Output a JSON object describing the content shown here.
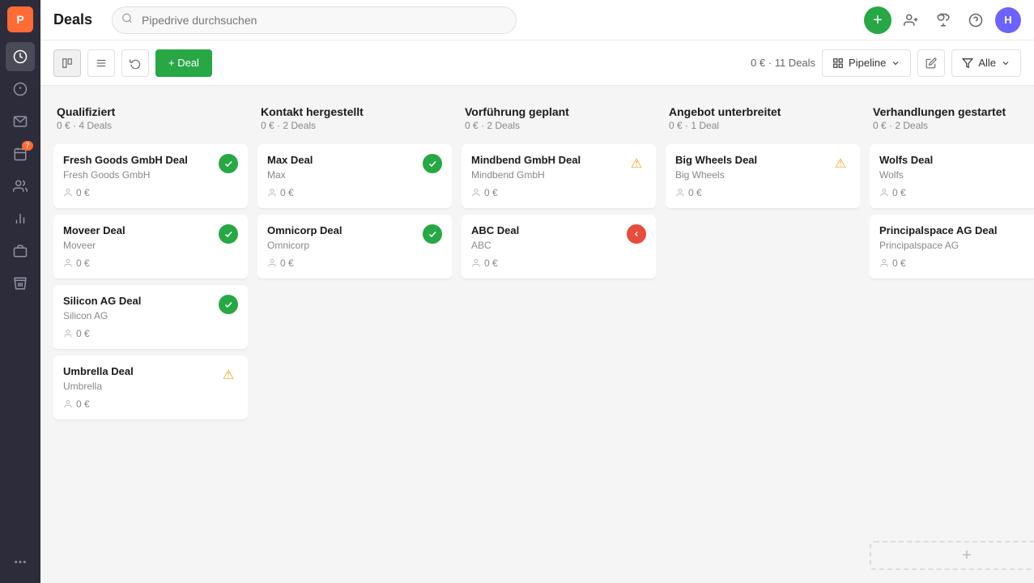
{
  "app": {
    "logo_letter": "P",
    "title": "Deals"
  },
  "sidebar": {
    "items": [
      {
        "name": "activity-feed",
        "icon": "clock",
        "active": true
      },
      {
        "name": "deals",
        "icon": "dollar",
        "active": false
      },
      {
        "name": "email",
        "icon": "email",
        "active": false
      },
      {
        "name": "calendar",
        "icon": "calendar",
        "badge": "7"
      },
      {
        "name": "contacts",
        "icon": "people",
        "active": false
      },
      {
        "name": "reports",
        "icon": "chart",
        "active": false
      },
      {
        "name": "products",
        "icon": "briefcase",
        "active": false
      },
      {
        "name": "marketplace",
        "icon": "store",
        "active": false
      }
    ],
    "more_label": "···"
  },
  "topbar": {
    "title": "Deals",
    "search_placeholder": "Pipedrive durchsuchen",
    "user_initial": "H"
  },
  "toolbar": {
    "add_deal_label": "+ Deal",
    "stats": "0 € · 11 Deals",
    "pipeline_label": "Pipeline",
    "filter_label": "Alle"
  },
  "columns": [
    {
      "id": "qualifiziert",
      "title": "Qualifiziert",
      "meta": "0 € · 4 Deals",
      "deals": [
        {
          "name": "Fresh Goods GmbH Deal",
          "company": "Fresh Goods GmbH",
          "amount": "0 €",
          "status": "green"
        },
        {
          "name": "Moveer Deal",
          "company": "Moveer",
          "amount": "0 €",
          "status": "green"
        },
        {
          "name": "Silicon AG Deal",
          "company": "Silicon AG",
          "amount": "0 €",
          "status": "green"
        },
        {
          "name": "Umbrella Deal",
          "company": "Umbrella",
          "amount": "0 €",
          "status": "warning"
        }
      ]
    },
    {
      "id": "kontakt",
      "title": "Kontakt hergestellt",
      "meta": "0 € · 2 Deals",
      "deals": [
        {
          "name": "Max Deal",
          "company": "Max",
          "amount": "0 €",
          "status": "green"
        },
        {
          "name": "Omnicorp Deal",
          "company": "Omnicorp",
          "amount": "0 €",
          "status": "green"
        }
      ]
    },
    {
      "id": "vorfuehrung",
      "title": "Vorführung geplant",
      "meta": "0 € · 2 Deals",
      "deals": [
        {
          "name": "Mindbend GmbH Deal",
          "company": "Mindbend GmbH",
          "amount": "0 €",
          "status": "warning"
        },
        {
          "name": "ABC Deal",
          "company": "ABC",
          "amount": "0 €",
          "status": "red-left"
        }
      ]
    },
    {
      "id": "angebot",
      "title": "Angebot unterbreitet",
      "meta": "0 € · 1 Deal",
      "deals": [
        {
          "name": "Big Wheels Deal",
          "company": "Big Wheels",
          "amount": "0 €",
          "status": "warning"
        }
      ]
    },
    {
      "id": "verhandlungen",
      "title": "Verhandlungen gestartet",
      "meta": "0 € · 2 Deals",
      "deals": [
        {
          "name": "Wolfs Deal",
          "company": "Wolfs",
          "amount": "0 €",
          "status": "red-left"
        },
        {
          "name": "Principalspace AG Deal",
          "company": "Principalspace AG",
          "amount": "0 €",
          "status": "warning"
        }
      ]
    }
  ],
  "icons": {
    "search": "🔍",
    "add": "+",
    "pipeline": "▦",
    "pencil": "✏",
    "filter": "≡",
    "chevron_down": "▾",
    "person": "👤",
    "arrow_right": "▶",
    "warning": "⚠",
    "arrow_left": "◀",
    "plus": "+"
  }
}
